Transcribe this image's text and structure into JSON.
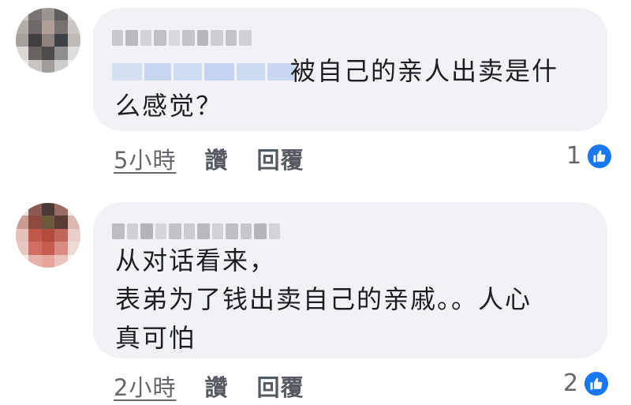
{
  "comments": [
    {
      "mention": "",
      "text": "被自己的亲人出卖是什",
      "text_line2": "么感觉？",
      "time": "5小時",
      "like_label": "讚",
      "reply_label": "回覆",
      "reaction_count": "1",
      "reaction_icon": "thumbs-up-icon"
    },
    {
      "text": "从对话看来，\n表弟为了钱出卖自己的亲戚。。人心\n真可怕",
      "time": "2小時",
      "like_label": "讚",
      "reply_label": "回覆",
      "reaction_count": "2",
      "reaction_icon": "thumbs-up-icon"
    }
  ],
  "colors": {
    "bubble": "#f0f2f5",
    "like_blue": "#1877f2",
    "meta_gray": "#65676b"
  }
}
